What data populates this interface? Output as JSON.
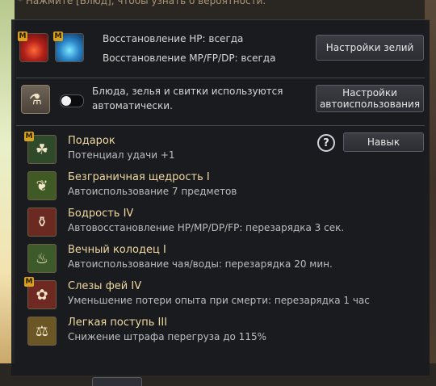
{
  "top_hint": "* Нажмите [Блюд], чтобы узнать о вероятности.",
  "potions": {
    "hp_line": "Восстановление HP: всегда",
    "mp_line": "Восстановление MP/FP/DP: всегда",
    "settings_button": "Настройки зелий",
    "hp_icon": "hp-potion-icon",
    "mp_icon": "mp-potion-icon"
  },
  "auto_use": {
    "text_line1": "Блюда, зелья и свитки используются",
    "text_line2": "автоматически.",
    "toggle_on": false,
    "settings_button_line1": "Настройки",
    "settings_button_line2": "автоиспользования"
  },
  "skills_header": {
    "skill_button": "Навык"
  },
  "skills": [
    {
      "name": "Подарок",
      "desc": "Потенциал удачи +1",
      "badge": "M",
      "icon": "clover-icon",
      "color": "#2f4a2a"
    },
    {
      "name": "Безграничная щедрость I",
      "desc": "Автоиспользование 7 предметов",
      "badge": "",
      "icon": "leaf-icon",
      "color": "#3f5a24"
    },
    {
      "name": "Бодрость IV",
      "desc": "Автовосстановление HP/MP/DP/FP: перезарядка 3 сек.",
      "badge": "",
      "icon": "potion-set-icon",
      "color": "#6a2a22"
    },
    {
      "name": "Вечный колодец I",
      "desc": "Автоиспользование чая/воды: перезарядка 20 мин.",
      "badge": "",
      "icon": "tea-icon",
      "color": "#3c5a2a"
    },
    {
      "name": "Слезы фей IV",
      "desc": "Уменьшение потери опыта при смерти: перезарядка 1 час",
      "badge": "M",
      "icon": "fairy-icon",
      "color": "#6e2a22"
    },
    {
      "name": "Легкая поступь III",
      "desc": "Снижение штрафа перегруза до 115%",
      "badge": "",
      "icon": "weight-icon",
      "color": "#6b5626"
    }
  ],
  "colors": {
    "panel_bg": "#1a1b1f",
    "skill_name": "#f0d9a0",
    "badge": "#d6a11e"
  }
}
